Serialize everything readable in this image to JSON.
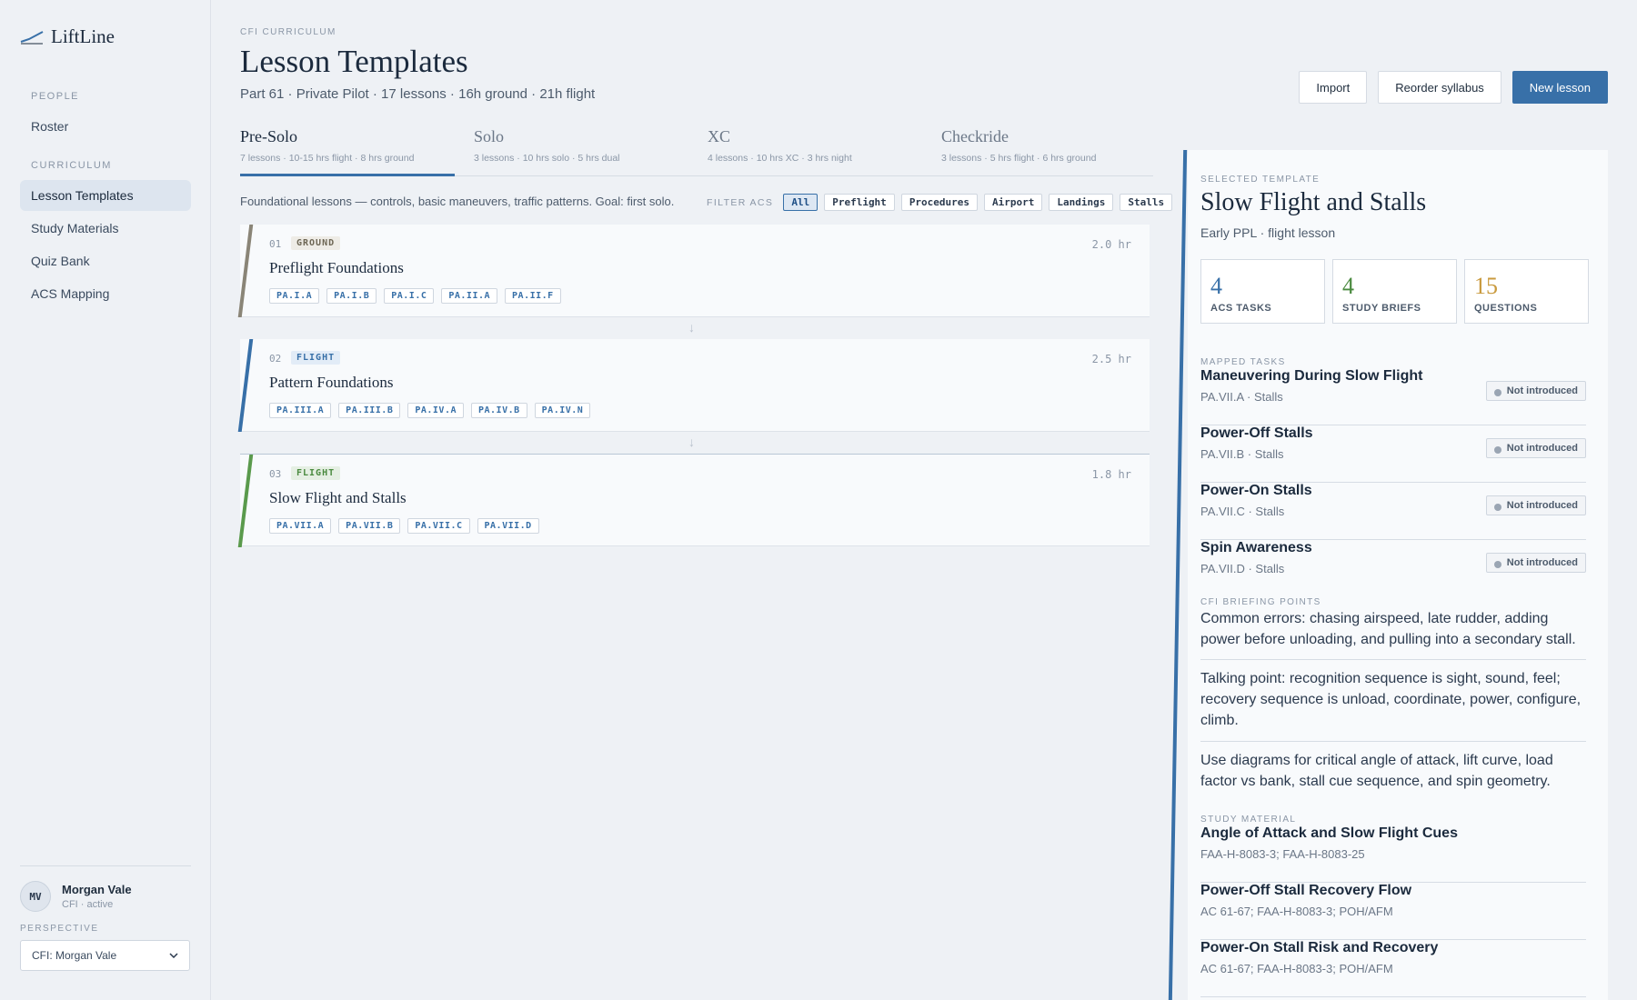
{
  "brand": {
    "name": "LiftLine"
  },
  "sidebar": {
    "people_heading": "PEOPLE",
    "people_items": [
      {
        "label": "Roster"
      }
    ],
    "curriculum_heading": "CURRICULUM",
    "curriculum_items": [
      {
        "label": "Lesson Templates",
        "active": true
      },
      {
        "label": "Study Materials"
      },
      {
        "label": "Quiz Bank"
      },
      {
        "label": "ACS Mapping"
      }
    ],
    "user": {
      "initials": "MV",
      "name": "Morgan Vale",
      "role": "CFI · active"
    },
    "perspective_label": "PERSPECTIVE",
    "perspective_value": "CFI: Morgan Vale"
  },
  "header": {
    "eyebrow": "CFI CURRICULUM",
    "title": "Lesson Templates",
    "subtitle": "Part 61 · Private Pilot · 17 lessons · 16h ground · 21h flight",
    "buttons": {
      "import": "Import",
      "reorder": "Reorder syllabus",
      "new": "New lesson"
    }
  },
  "tabs": [
    {
      "label": "Pre-Solo",
      "meta": "7 lessons · 10-15 hrs flight · 8 hrs ground",
      "active": true
    },
    {
      "label": "Solo",
      "meta": "3 lessons · 10 hrs solo · 5 hrs dual"
    },
    {
      "label": "XC",
      "meta": "4 lessons · 10 hrs XC · 3 hrs night"
    },
    {
      "label": "Checkride",
      "meta": "3 lessons · 5 hrs flight · 6 hrs ground"
    }
  ],
  "description": "Foundational lessons — controls, basic maneuvers, traffic patterns. Goal: first solo.",
  "filter": {
    "label": "FILTER ACS",
    "chips": [
      "All",
      "Preflight",
      "Procedures",
      "Airport",
      "Landings",
      "Stalls"
    ],
    "active": "All"
  },
  "lessons": [
    {
      "num": "01",
      "type": "GROUND",
      "hours": "2.0 hr",
      "title": "Preflight Foundations",
      "codes": [
        "PA.I.A",
        "PA.I.B",
        "PA.I.C",
        "PA.II.A",
        "PA.II.F"
      ],
      "bar_color": "#8a8577"
    },
    {
      "num": "02",
      "type": "FLIGHT",
      "hours": "2.5 hr",
      "title": "Pattern Foundations",
      "codes": [
        "PA.III.A",
        "PA.III.B",
        "PA.IV.A",
        "PA.IV.B",
        "PA.IV.N"
      ],
      "bar_color": "#3870a8"
    },
    {
      "num": "03",
      "type": "FLIGHT",
      "hours": "1.8 hr",
      "title": "Slow Flight and Stalls",
      "codes": [
        "PA.VII.A",
        "PA.VII.B",
        "PA.VII.C",
        "PA.VII.D"
      ],
      "bar_color": "#5a9a4c"
    }
  ],
  "panel": {
    "eyebrow": "SELECTED TEMPLATE",
    "title": "Slow Flight and Stalls",
    "subtitle": "Early PPL · flight lesson",
    "stats": [
      {
        "value": "4",
        "label": "ACS TASKS",
        "color": "#3870a8"
      },
      {
        "value": "4",
        "label": "STUDY BRIEFS",
        "color": "#4a8a3f"
      },
      {
        "value": "15",
        "label": "QUESTIONS",
        "color": "#c99a3e"
      }
    ],
    "mapped_heading": "MAPPED TASKS",
    "tasks": [
      {
        "title": "Maneuvering During Slow Flight",
        "sub": "PA.VII.A · Stalls",
        "status": "Not introduced"
      },
      {
        "title": "Power-Off Stalls",
        "sub": "PA.VII.B · Stalls",
        "status": "Not introduced"
      },
      {
        "title": "Power-On Stalls",
        "sub": "PA.VII.C · Stalls",
        "status": "Not introduced"
      },
      {
        "title": "Spin Awareness",
        "sub": "PA.VII.D · Stalls",
        "status": "Not introduced"
      }
    ],
    "briefing_heading": "CFI BRIEFING POINTS",
    "briefing": [
      "Common errors: chasing airspeed, late rudder, adding power before unloading, and pulling into a secondary stall.",
      "Talking point: recognition sequence is sight, sound, feel; recovery sequence is unload, coordinate, power, configure, climb.",
      "Use diagrams for critical angle of attack, lift curve, load factor vs bank, stall cue sequence, and spin geometry."
    ],
    "study_heading": "STUDY MATERIAL",
    "materials": [
      {
        "title": "Angle of Attack and Slow Flight Cues",
        "sub": "FAA-H-8083-3; FAA-H-8083-25"
      },
      {
        "title": "Power-Off Stall Recovery Flow",
        "sub": "AC 61-67; FAA-H-8083-3; POH/AFM"
      },
      {
        "title": "Power-On Stall Risk and Recovery",
        "sub": "AC 61-67; FAA-H-8083-3; POH/AFM"
      }
    ]
  }
}
